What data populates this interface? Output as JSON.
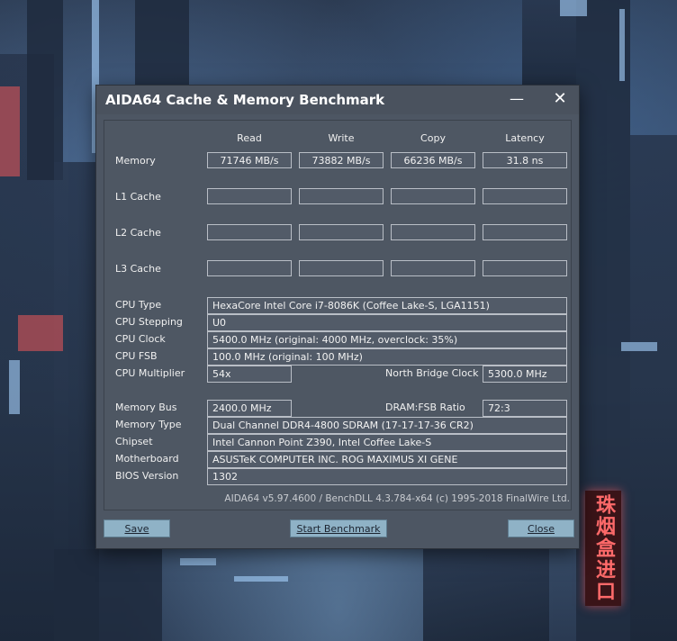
{
  "window": {
    "title": "AIDA64 Cache & Memory Benchmark",
    "minimize_glyph": "—",
    "close_glyph": "✕"
  },
  "columns": [
    "Read",
    "Write",
    "Copy",
    "Latency"
  ],
  "cache_rows": [
    {
      "label": "Memory",
      "values": [
        "71746 MB/s",
        "73882 MB/s",
        "66236 MB/s",
        "31.8 ns"
      ]
    },
    {
      "label": "L1 Cache",
      "values": [
        "",
        "",
        "",
        ""
      ]
    },
    {
      "label": "L2 Cache",
      "values": [
        "",
        "",
        "",
        ""
      ]
    },
    {
      "label": "L3 Cache",
      "values": [
        "",
        "",
        "",
        ""
      ]
    }
  ],
  "cpu": {
    "type_label": "CPU Type",
    "type_value": "HexaCore Intel Core i7-8086K  (Coffee Lake-S, LGA1151)",
    "stepping_label": "CPU Stepping",
    "stepping_value": "U0",
    "clock_label": "CPU Clock",
    "clock_value": "5400.0 MHz  (original: 4000 MHz, overclock: 35%)",
    "fsb_label": "CPU FSB",
    "fsb_value": "100.0 MHz  (original: 100 MHz)",
    "multiplier_label": "CPU Multiplier",
    "multiplier_value": "54x",
    "nb_clock_label": "North Bridge Clock",
    "nb_clock_value": "5300.0 MHz"
  },
  "memory": {
    "bus_label": "Memory Bus",
    "bus_value": "2400.0 MHz",
    "ratio_label": "DRAM:FSB Ratio",
    "ratio_value": "72:3",
    "type_label": "Memory Type",
    "type_value": "Dual Channel DDR4-4800 SDRAM  (17-17-17-36 CR2)",
    "chipset_label": "Chipset",
    "chipset_value": "Intel Cannon Point Z390, Intel Coffee Lake-S",
    "motherboard_label": "Motherboard",
    "motherboard_value": "ASUSTeK COMPUTER INC. ROG MAXIMUS XI GENE",
    "bios_label": "BIOS Version",
    "bios_value": "1302"
  },
  "footer": "AIDA64 v5.97.4600 / BenchDLL 4.3.784-x64  (c) 1995-2018 FinalWire Ltd.",
  "buttons": {
    "save": "Save",
    "start": "Start Benchmark",
    "close": "Close"
  },
  "background": {
    "neon_sign": "珠烟盒进口"
  }
}
